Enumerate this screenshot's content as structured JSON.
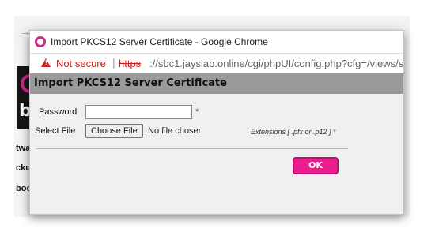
{
  "window": {
    "title": "Import PKCS12 Server Certificate - Google Chrome",
    "icon": "chrome-icon"
  },
  "address_bar": {
    "security_label": "Not secure",
    "separator": "|",
    "scheme": "https",
    "url_rest": "://sbc1.jayslab.online/cgi/phpUI/config.php?cfg=/views/s"
  },
  "background_page": {
    "logo_text": "bo",
    "side_labels": [
      "twa",
      "ckup",
      "boot"
    ]
  },
  "dialog": {
    "title": "Import PKCS12 Server Certificate",
    "password_label": "Password",
    "password_value": "",
    "required_mark": "*",
    "select_file_label": "Select File",
    "choose_file_label": "Choose File",
    "no_file_text": "No file chosen",
    "extensions_note": "Extensions [ .pfx or .p12 ] *",
    "ok_label": "OK"
  },
  "colors": {
    "accent": "#e91e8c",
    "warning": "#c5221f",
    "header_bg": "#9a9a9a"
  }
}
